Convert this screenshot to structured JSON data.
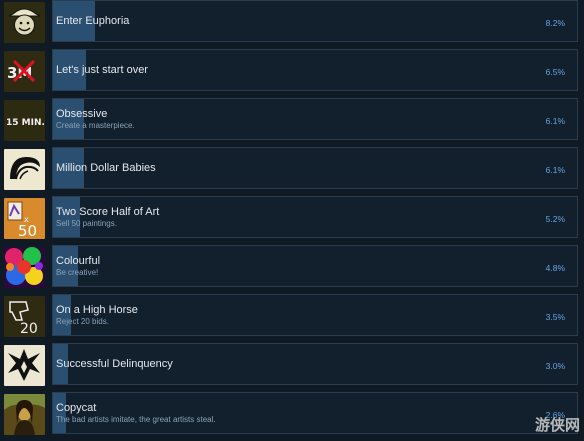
{
  "achievements": [
    {
      "title": "Enter Euphoria",
      "description": "",
      "percent": "8.2%",
      "fill": 0.082,
      "icon": "cowboy-face-icon"
    },
    {
      "title": "Let's just start over",
      "description": "",
      "percent": "6.5%",
      "fill": 0.065,
      "icon": "3m-crossed-icon"
    },
    {
      "title": "Obsessive",
      "description": "Create a masterpiece.",
      "percent": "6.1%",
      "fill": 0.061,
      "icon": "15-min-icon"
    },
    {
      "title": "Million Dollar Babies",
      "description": "",
      "percent": "6.1%",
      "fill": 0.061,
      "icon": "hair-icon"
    },
    {
      "title": "Two Score Half of Art",
      "description": "Sell 50 paintings.",
      "percent": "5.2%",
      "fill": 0.052,
      "icon": "paintings-x50-icon"
    },
    {
      "title": "Colourful",
      "description": "Be creative!",
      "percent": "4.8%",
      "fill": 0.048,
      "icon": "colour-splash-icon"
    },
    {
      "title": "On a High Horse",
      "description": "Reject 20 bids.",
      "percent": "3.5%",
      "fill": 0.035,
      "icon": "thumbs-down-20-icon"
    },
    {
      "title": "Successful Delinquency",
      "description": "",
      "percent": "3.0%",
      "fill": 0.03,
      "icon": "broken-glass-icon"
    },
    {
      "title": "Copycat",
      "description": "The bad artists imitate, the great artists steal.",
      "percent": "2.6%",
      "fill": 0.026,
      "icon": "mona-lisa-icon"
    }
  ],
  "icon_text": {
    "three_m": "3M",
    "fifteen_min": "15 MIN.",
    "x": "x",
    "fifty": "50",
    "twenty": "20"
  },
  "watermark": "游侠网",
  "colors": {
    "background": "#0f1a24",
    "progress": "#2b4f70",
    "percent": "#68a6e6"
  }
}
